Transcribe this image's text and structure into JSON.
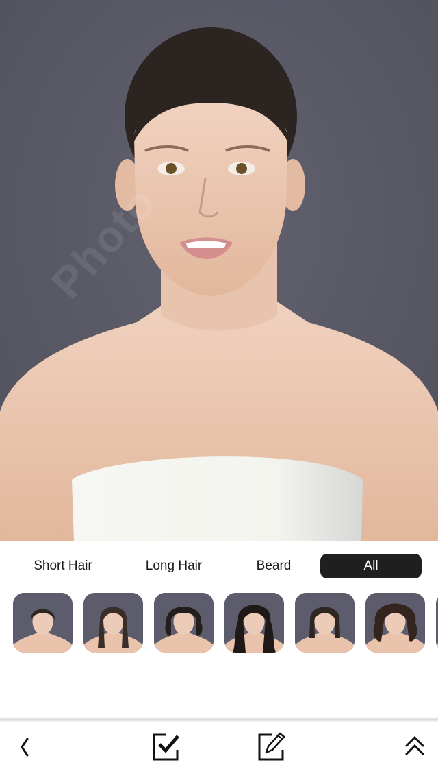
{
  "photo": {
    "description": "portrait-preview",
    "watermark_text": "Photo",
    "colors": {
      "background": "#5a5a6a",
      "skin": "#e9c3ab",
      "hair": "#2c2420",
      "dress": "#f4f4f0"
    }
  },
  "filters": {
    "items": [
      {
        "label": "Short Hair",
        "active": false
      },
      {
        "label": "Long Hair",
        "active": false
      },
      {
        "label": "Beard",
        "active": false
      },
      {
        "label": "All",
        "active": true
      }
    ],
    "active_color": "#1f1f1f"
  },
  "hairstyles": [
    {
      "name": "slicked-back",
      "hair_color": "#2e2622"
    },
    {
      "name": "long-straight",
      "hair_color": "#3a2c26"
    },
    {
      "name": "short-wavy-bob",
      "hair_color": "#231d1b"
    },
    {
      "name": "long-wavy",
      "hair_color": "#1e1816"
    },
    {
      "name": "straight-bob",
      "hair_color": "#2f2521"
    },
    {
      "name": "curly-volume",
      "hair_color": "#33251e"
    },
    {
      "name": "partial-next",
      "hair_color": "#2a2220"
    }
  ],
  "toolbar": {
    "back_icon": "chevron-left",
    "confirm_icon": "checkbox-check",
    "edit_icon": "edit-pencil",
    "expand_icon": "double-chevron-up"
  }
}
